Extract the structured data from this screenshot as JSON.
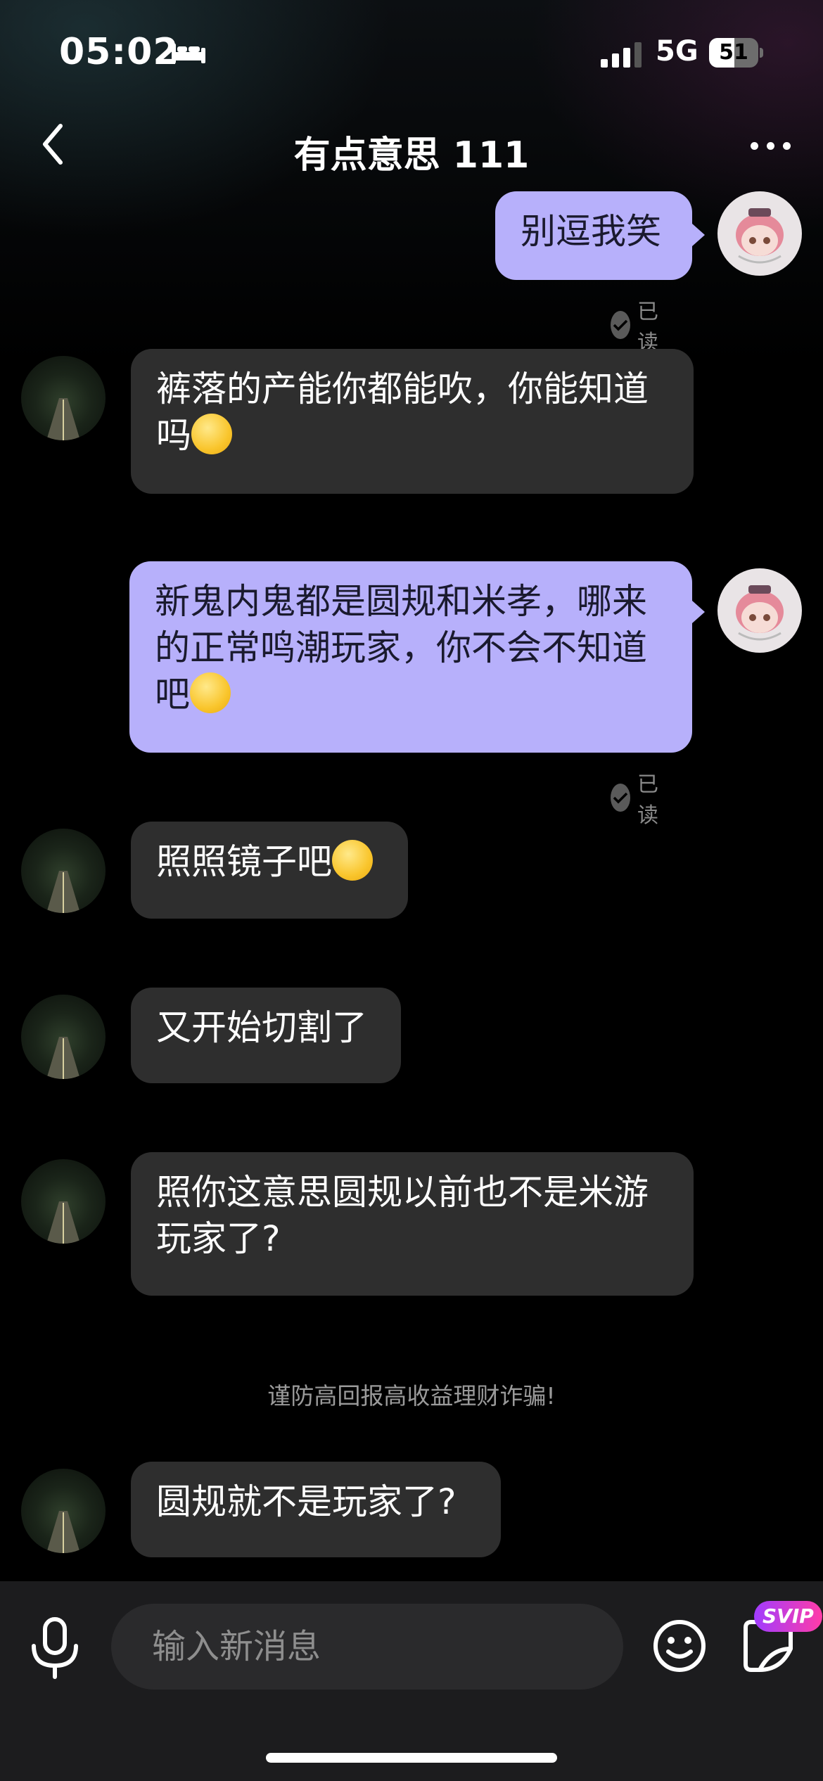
{
  "status_bar": {
    "time": "05:02",
    "network": "5G",
    "battery": "51",
    "battery_level": 0.51
  },
  "header": {
    "title": "有点意思 111"
  },
  "messages": [
    {
      "from": "me",
      "text": "别逗我笑",
      "read_label": "已读"
    },
    {
      "from": "other",
      "text": "裤落的产能你都能吹，你能知道吗"
    },
    {
      "from": "me",
      "text": "新鬼内鬼都是圆规和米孝，哪来的正常鸣潮玩家，你不会不知道吧",
      "read_label": "已读"
    },
    {
      "from": "other",
      "text": "照照镜子吧"
    },
    {
      "from": "other",
      "text": "又开始切割了"
    },
    {
      "from": "other",
      "text": "照你这意思圆规以前也不是米游玩家了?"
    },
    {
      "from": "other",
      "text": "圆规就不是玩家了?"
    }
  ],
  "system_notice": "谨防高回报高收益理财诈骗!",
  "input": {
    "placeholder": "输入新消息"
  },
  "badges": {
    "svip": "SVIP"
  },
  "colors": {
    "outgoing_bubble": "#b7b0fb",
    "incoming_bubble": "#2e2e2e",
    "background": "#000000"
  }
}
